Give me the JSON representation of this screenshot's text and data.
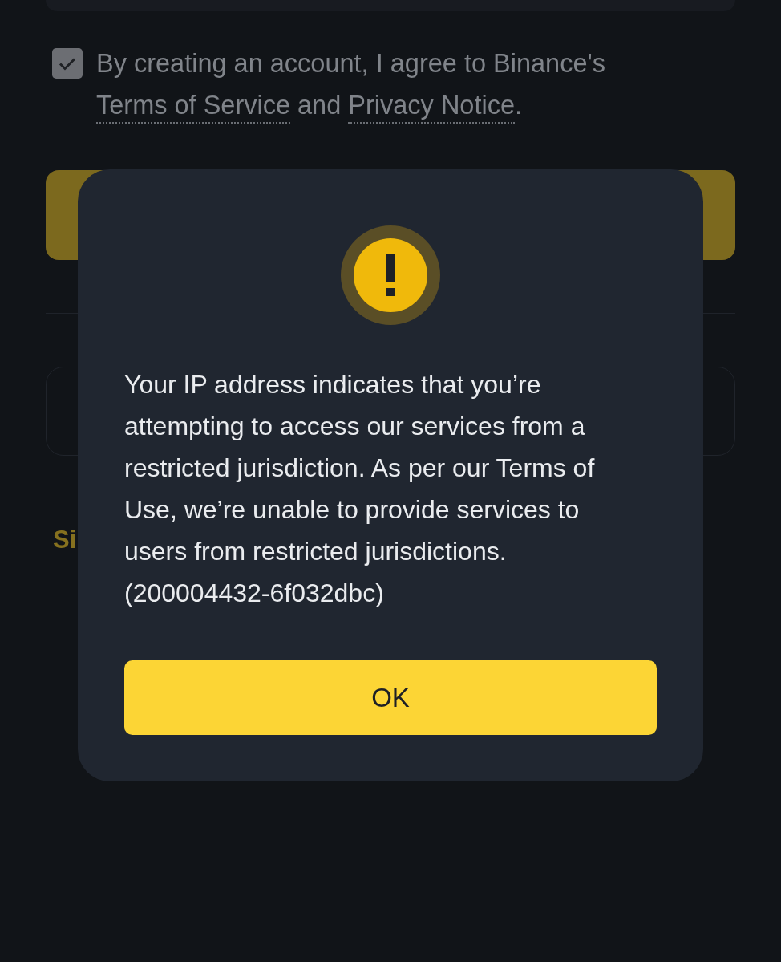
{
  "signup_form": {
    "agreement": {
      "checked": true,
      "segments": [
        {
          "kind": "text",
          "text": "By creating an account, I agree to Binance's "
        },
        {
          "kind": "link",
          "text": "Terms of Service"
        },
        {
          "kind": "text",
          "text": " and "
        },
        {
          "kind": "link",
          "text": "Privacy Notice"
        },
        {
          "kind": "text",
          "text": "."
        }
      ]
    },
    "signin_prompt": "Si"
  },
  "dialog": {
    "message": "Your IP address indicates that you’re attempting to access our services from a restricted jurisdiction. As per our Terms of Use, we’re unable to provide services to users from restricted jurisdictions. (200004432-6f032dbc)",
    "ok_button": "OK"
  }
}
